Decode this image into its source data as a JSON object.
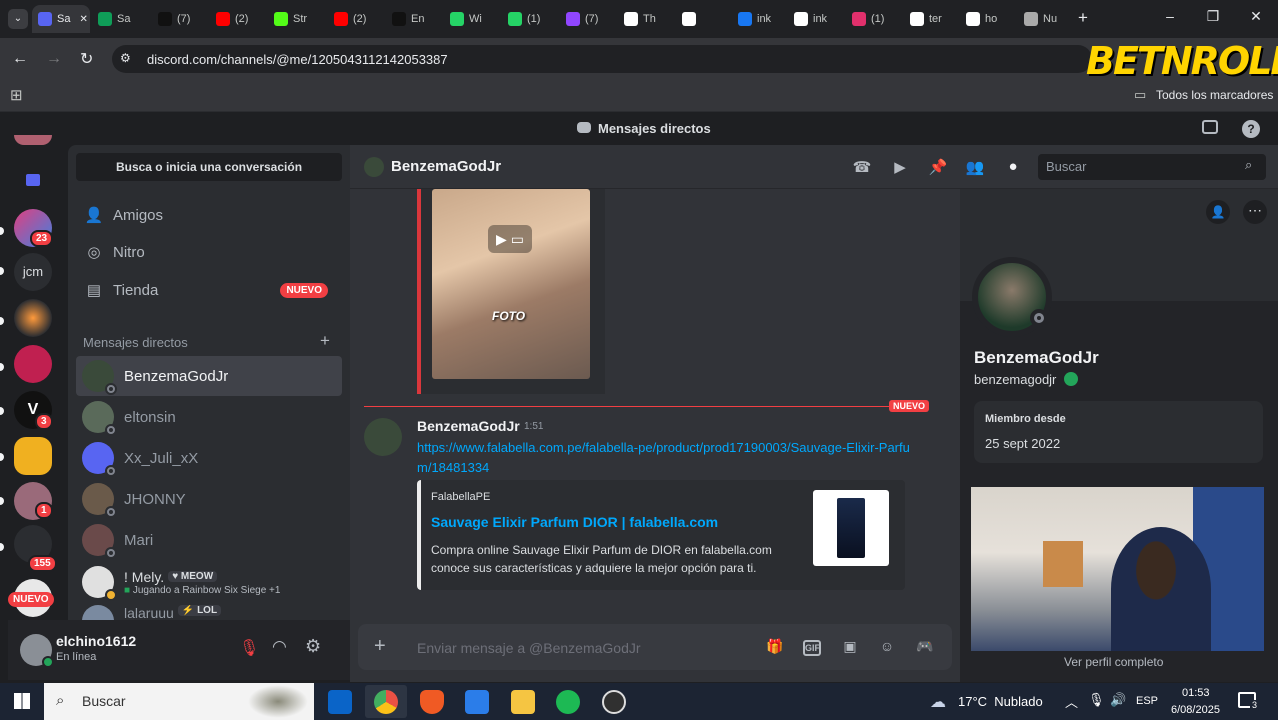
{
  "browser": {
    "tabs": [
      {
        "label": "Sa",
        "color": "#5865f2"
      },
      {
        "label": "Sa",
        "color": "#0f9d58"
      },
      {
        "label": "(7)",
        "color": "#111111"
      },
      {
        "label": "(2)",
        "color": "#ff0000"
      },
      {
        "label": "Str",
        "color": "#53fc18"
      },
      {
        "label": "(2)",
        "color": "#ff0000"
      },
      {
        "label": "En",
        "color": "#111111"
      },
      {
        "label": "Wi",
        "color": "#25d366"
      },
      {
        "label": "(1)",
        "color": "#25d366"
      },
      {
        "label": "(7)",
        "color": "#9146ff"
      },
      {
        "label": "Th",
        "color": "#ffffff"
      },
      {
        "label": "",
        "color": "#ffffff"
      },
      {
        "label": "ink",
        "color": "#1877f2"
      },
      {
        "label": "ink",
        "color": "#ffffff"
      },
      {
        "label": "(1)",
        "color": "#e1306c"
      },
      {
        "label": "ter",
        "color": "#ffffff"
      },
      {
        "label": "ho",
        "color": "#ffffff"
      },
      {
        "label": "Nu",
        "color": "#aaaaaa"
      }
    ],
    "url": "discord.com/channels/@me/1205043112142053387",
    "bookmarks_label": "Todos los marcadores"
  },
  "overlay_logo": "BET N ROLL",
  "discord": {
    "title": "Mensajes directos",
    "search_conversation": "Busca o inicia una conversación",
    "nav": [
      {
        "label": "Amigos",
        "icon": "friends-icon"
      },
      {
        "label": "Nitro",
        "icon": "nitro-icon"
      },
      {
        "label": "Tienda",
        "icon": "shop-icon",
        "badge": "NUEVO"
      }
    ],
    "dm_header": "Mensajes directos",
    "dms": [
      {
        "name": "BenzemaGodJr",
        "color": "#3a4a3a",
        "selected": true
      },
      {
        "name": "eltonsin",
        "color": "#5a6a5a"
      },
      {
        "name": "Xx_Juli_xX",
        "color": "#5865f2"
      },
      {
        "name": "JHONNY",
        "color": "#6a5a4a"
      },
      {
        "name": "Mari",
        "color": "#6a4a4a"
      }
    ],
    "dm_mely": {
      "name": "! Mely.",
      "tag": "MEOW",
      "activity": "Jugando a Rainbow Six Siege +1"
    },
    "dm_lalaruuu": {
      "name": "lalaruuu",
      "tag": "LOL"
    },
    "servers": {
      "jcm_label": "jcm",
      "badges": [
        "23",
        "3",
        "1",
        "155"
      ],
      "nuevo": "NUEVO"
    },
    "user": {
      "name": "elchino1612",
      "status": "En línea"
    },
    "chat": {
      "header_name": "BenzemaGodJr",
      "search_placeholder": "Buscar",
      "video_caption": "FOTO",
      "new_divider": "NUEVO",
      "message": {
        "author": "BenzemaGodJr",
        "time": "1:51",
        "link": "https://www.falabella.com.pe/falabella-pe/product/prod17190003/Sauvage-Elixir-Parfum/18481334",
        "embed": {
          "site": "FalabellaPE",
          "title": "Sauvage Elixir Parfum DIOR | falabella.com",
          "description": "Compra online Sauvage Elixir Parfum de DIOR en falabella.com conoce sus características y adquiere la mejor opción para ti."
        }
      },
      "composer_placeholder": "Enviar mensaje a @BenzemaGodJr"
    },
    "profile": {
      "display_name": "BenzemaGodJr",
      "username": "benzemagodjr",
      "member_since_label": "Miembro desde",
      "member_since": "25 sept 2022",
      "view_full": "Ver perfil completo"
    }
  },
  "taskbar": {
    "search": "Buscar",
    "weather": "17°C  Nublado",
    "lang": "ESP",
    "time": "01:53",
    "date": "6/08/2025",
    "notif_count": "3"
  }
}
